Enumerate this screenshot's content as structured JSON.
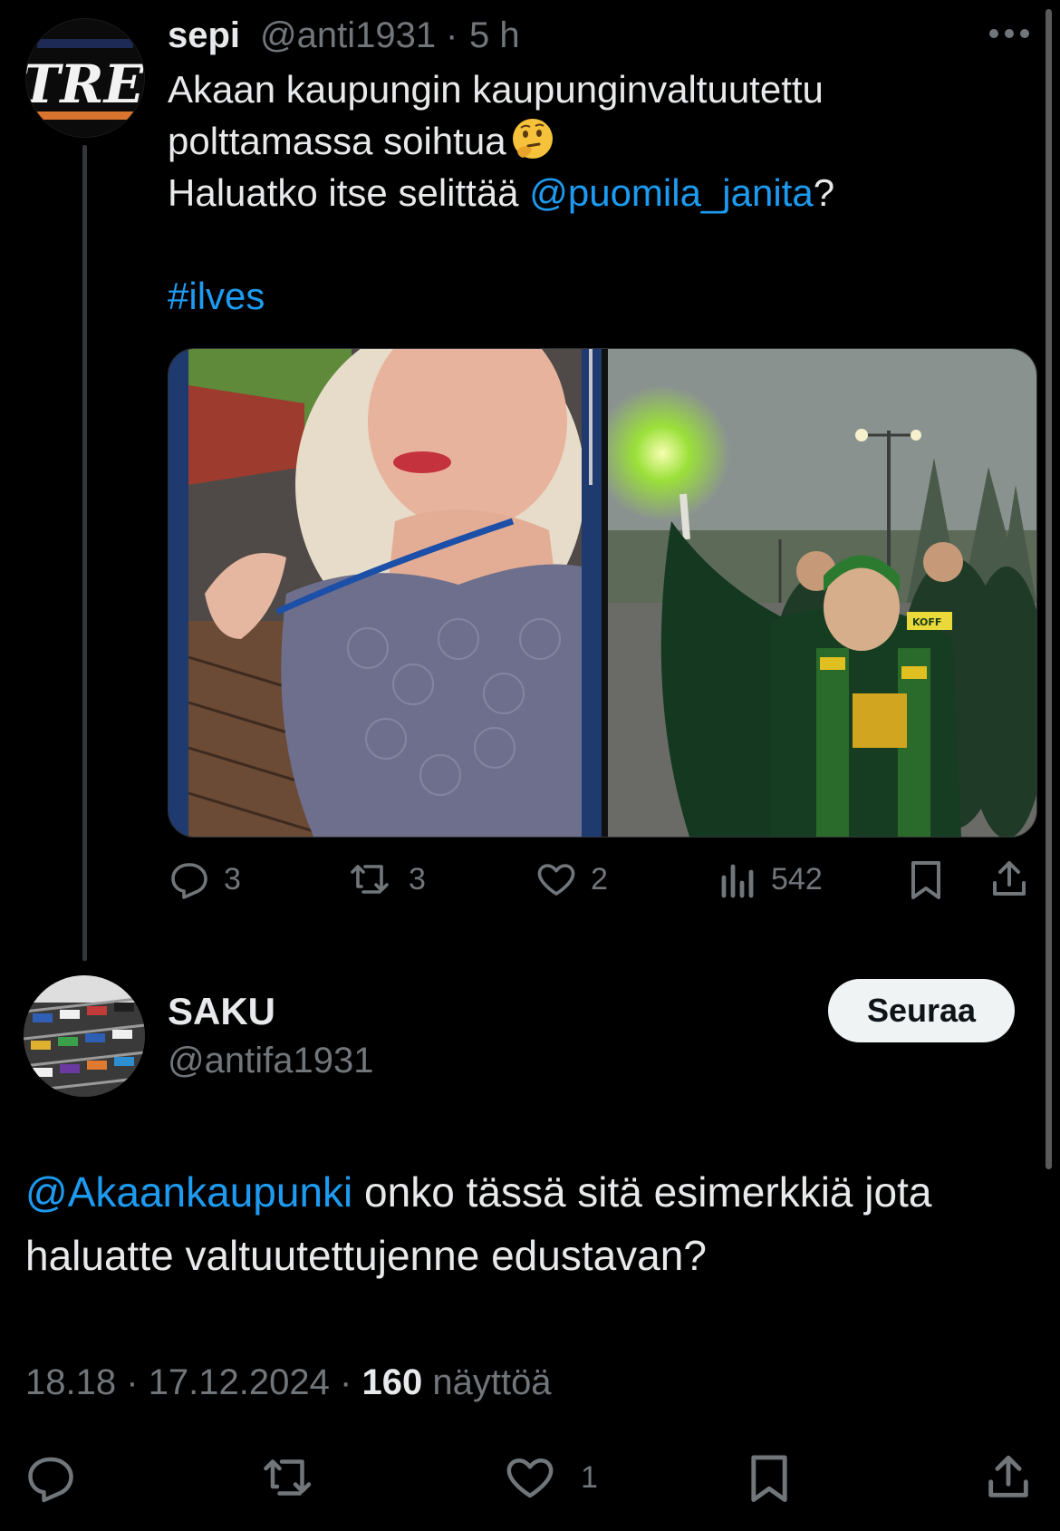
{
  "parent_tweet": {
    "display_name": "sepi",
    "handle": "@anti1931",
    "separator": "·",
    "time": "5 h",
    "avatar_text": "TRE",
    "text_line1": "Akaan kaupungin kaupunginvaltuutettu",
    "text_line2": "polttamassa soihtua",
    "text_line3_pre": "Haluatko itse selittää ",
    "mention": "@puomila_janita",
    "text_line3_post": "?",
    "hashtag": "#ilves",
    "stats": {
      "replies": "3",
      "reposts": "3",
      "likes": "2",
      "views": "542"
    }
  },
  "main_tweet": {
    "display_name": "SAKU",
    "handle": "@antifa1931",
    "follow_label": "Seuraa",
    "mention": "@Akaankaupunki",
    "text_line1_post": " onko tässä sitä esimerkkiä jota",
    "text_line2": "haluatte valtuutettujenne edustavan?",
    "time": "18.18",
    "date": "17.12.2024",
    "separator": "·",
    "view_count": "160",
    "view_label": "näyttöä",
    "like_count": "1"
  },
  "icons": [
    "more-icon",
    "reply-icon",
    "repost-icon",
    "like-icon",
    "views-icon",
    "bookmark-icon",
    "share-icon",
    "thinking-face-emoji"
  ],
  "colors": {
    "background": "#000000",
    "text": "#e7e9ea",
    "muted": "#71767b",
    "link": "#1d9bf0",
    "follow_button_bg": "#eff3f4"
  }
}
